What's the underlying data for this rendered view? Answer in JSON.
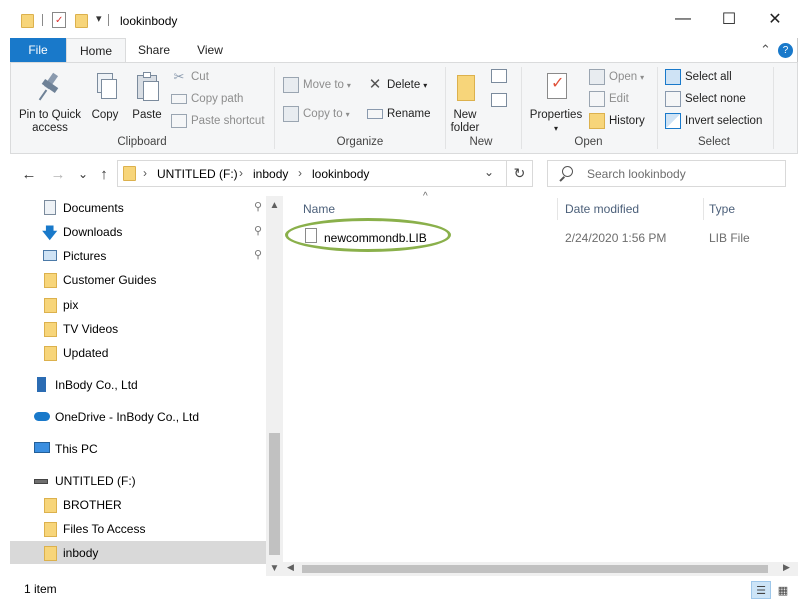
{
  "window": {
    "title": "lookinbody"
  },
  "title_controls": {
    "minimize": "—",
    "maximize": "☐",
    "close": "✕",
    "qat_dropdown": "▾"
  },
  "ribbon_tabs": {
    "file": "File",
    "home": "Home",
    "share": "Share",
    "view": "View",
    "expand_icon": "⌃",
    "help_icon": "?"
  },
  "ribbon": {
    "clipboard": {
      "label": "Clipboard",
      "pin_line1": "Pin to Quick",
      "pin_line2": "access",
      "copy": "Copy",
      "paste": "Paste",
      "cut": "Cut",
      "copy_path": "Copy path",
      "paste_shortcut": "Paste shortcut"
    },
    "organize": {
      "label": "Organize",
      "move_to": "Move to",
      "copy_to": "Copy to",
      "delete": "Delete",
      "rename": "Rename"
    },
    "new": {
      "label": "New",
      "new_folder_line1": "New",
      "new_folder_line2": "folder"
    },
    "open": {
      "label": "Open",
      "properties": "Properties",
      "open": "Open",
      "edit": "Edit",
      "history": "History"
    },
    "select": {
      "label": "Select",
      "select_all": "Select all",
      "select_none": "Select none",
      "invert_selection": "Invert selection"
    }
  },
  "navigation": {
    "back": "←",
    "forward": "→",
    "recent": "⌄",
    "up": "↑",
    "breadcrumb": [
      "UNTITLED (F:)",
      "inbody",
      "lookinbody"
    ],
    "separator": "›",
    "dropdown": "⌄",
    "refresh": "↻",
    "search_placeholder": "Search lookinbody"
  },
  "nav_pane": {
    "items": [
      {
        "label": "Documents",
        "icon": "documents-icon",
        "pinned": true
      },
      {
        "label": "Downloads",
        "icon": "downloads-icon",
        "pinned": true
      },
      {
        "label": "Pictures",
        "icon": "pictures-icon",
        "pinned": true
      },
      {
        "label": "Customer Guides",
        "icon": "folder-icon"
      },
      {
        "label": "pix",
        "icon": "folder-icon"
      },
      {
        "label": "TV Videos",
        "icon": "folder-icon"
      },
      {
        "label": "Updated",
        "icon": "folder-icon"
      },
      {
        "label": "InBody Co., Ltd",
        "icon": "building-icon"
      },
      {
        "label": "OneDrive - InBody Co., Ltd",
        "icon": "onedrive-icon"
      },
      {
        "label": "This PC",
        "icon": "pc-icon"
      },
      {
        "label": "UNTITLED (F:)",
        "icon": "drive-icon"
      },
      {
        "label": "BROTHER",
        "icon": "folder-icon"
      },
      {
        "label": "Files To Access",
        "icon": "folder-icon"
      },
      {
        "label": "inbody",
        "icon": "folder-icon",
        "selected": true
      }
    ],
    "pin_glyph": "📌"
  },
  "file_list": {
    "columns": {
      "name": "Name",
      "date_modified": "Date modified",
      "type": "Type"
    },
    "sort_glyph": "^",
    "files": [
      {
        "name": "newcommondb.LIB",
        "date_modified": "2/24/2020 1:56 PM",
        "type": "LIB File"
      }
    ]
  },
  "status_bar": {
    "item_count": "1 item"
  },
  "colors": {
    "accent": "#1979ca",
    "highlight_ring": "#8ab04b",
    "folder": "#f7d57a"
  }
}
